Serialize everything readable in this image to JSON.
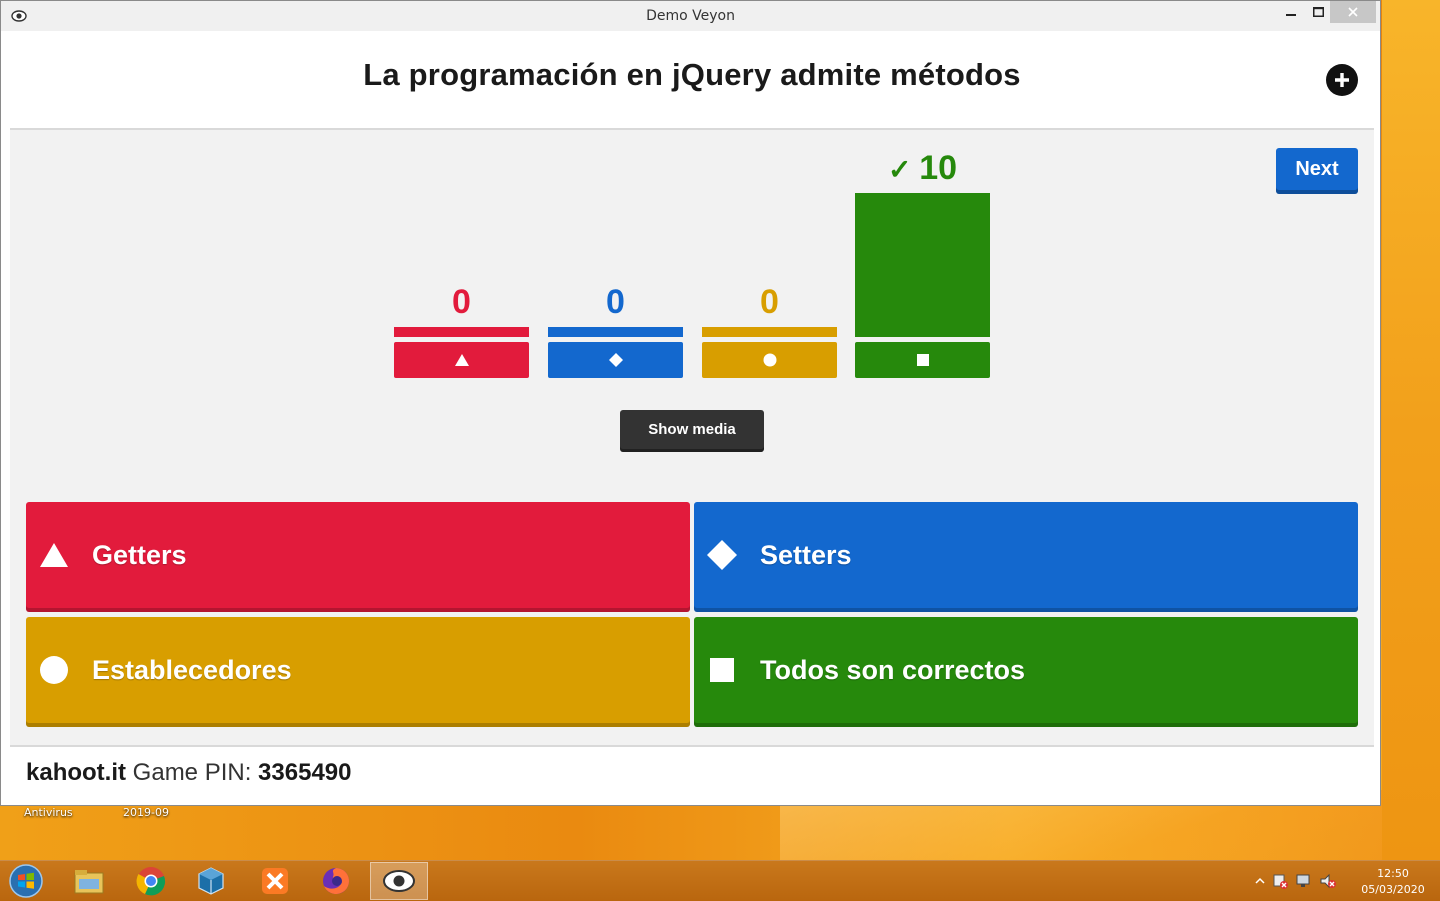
{
  "window": {
    "title": "Demo Veyon"
  },
  "question": {
    "text": "La programación en jQuery admite métodos"
  },
  "controls": {
    "next_label": "Next",
    "show_media_label": "Show media"
  },
  "results": [
    {
      "shape": "triangle",
      "count": "0",
      "value": 0,
      "color": "#e21b3c",
      "correct": false
    },
    {
      "shape": "diamond",
      "count": "0",
      "value": 0,
      "color": "#1368ce",
      "correct": false
    },
    {
      "shape": "circle",
      "count": "0",
      "value": 0,
      "color": "#d89e00",
      "correct": false
    },
    {
      "shape": "square",
      "count": "10",
      "value": 10,
      "color": "#26890c",
      "correct": true,
      "check_mark": "✓"
    }
  ],
  "answers": [
    {
      "shape": "triangle",
      "label": "Getters",
      "color": "#e21b3c"
    },
    {
      "shape": "diamond",
      "label": "Setters",
      "color": "#1368ce"
    },
    {
      "shape": "circle",
      "label": "Establecedores",
      "color": "#d89e00"
    },
    {
      "shape": "square",
      "label": "Todos son correctos",
      "color": "#26890c"
    }
  ],
  "footer": {
    "brand": "kahoot.it",
    "pin_label": "Game PIN:",
    "pin": "3365490"
  },
  "desktop": {
    "icon_labels": [
      "Antivirus",
      "2019-09"
    ]
  },
  "taskbar": {
    "items": [
      "start-orb-icon",
      "file-explorer-icon",
      "chrome-icon",
      "virtualbox-icon",
      "xampp-icon",
      "firefox-icon",
      "veyon-icon"
    ],
    "active": "veyon-icon",
    "clock": {
      "time": "12:50",
      "date": "05/03/2020"
    }
  }
}
